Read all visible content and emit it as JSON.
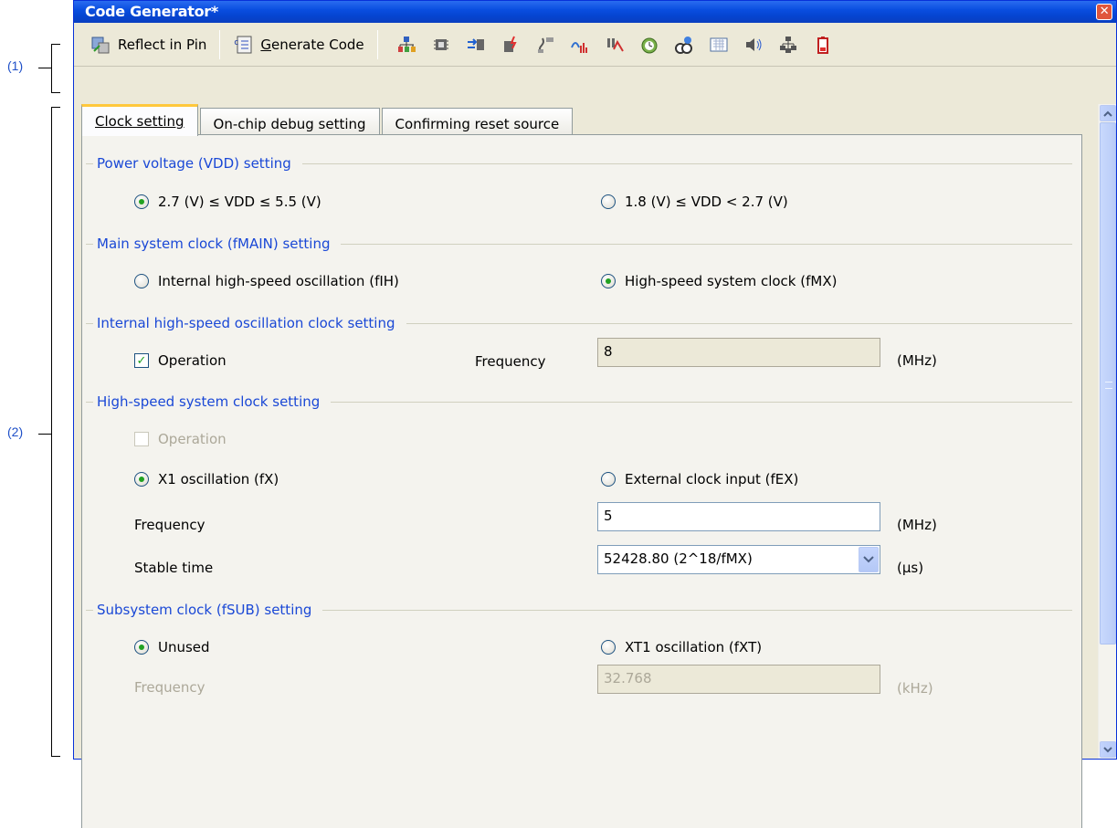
{
  "callouts": {
    "c1": "(1)",
    "c2": "(2)"
  },
  "window": {
    "title": "Code Generator*",
    "close_glyph": "✕"
  },
  "toolbar": {
    "reflect_label": "Reflect in Pin",
    "generate_label": "Generate Code",
    "icon_names": [
      "pin-config-icon",
      "chip-icon",
      "port-icon",
      "interrupt-icon",
      "serial-icon",
      "ad-converter-icon",
      "timer-icon",
      "watchdog-icon",
      "clock-output-icon",
      "display-icon",
      "buzzer-icon",
      "network-icon",
      "battery-icon"
    ]
  },
  "tabs": [
    "Clock setting",
    "On-chip debug setting",
    "Confirming reset source"
  ],
  "groups": {
    "power": "Power voltage (VDD) setting",
    "main_clock": "Main system clock (fMAIN) setting",
    "internal": "Internal high-speed oscillation clock setting",
    "highspeed": "High-speed system clock setting",
    "subsystem": "Subsystem clock (fSUB) setting"
  },
  "power": {
    "opt1": "2.7 (V) ≤ VDD ≤ 5.5 (V)",
    "opt2": "1.8 (V) ≤ VDD < 2.7 (V)"
  },
  "main_clock": {
    "opt1": "Internal high-speed oscillation (fIH)",
    "opt2": "High-speed system clock (fMX)"
  },
  "internal": {
    "operation_label": "Operation",
    "frequency_label": "Frequency",
    "frequency_value": "8",
    "unit": "(MHz)"
  },
  "highspeed": {
    "operation_label": "Operation",
    "opt1": "X1 oscillation (fX)",
    "opt2": "External clock input (fEX)",
    "frequency_label": "Frequency",
    "frequency_value": "5",
    "frequency_unit": "(MHz)",
    "stable_label": "Stable time",
    "stable_value": "52428.80 (2^18/fMX)",
    "stable_unit": "(µs)"
  },
  "subsystem": {
    "opt1": "Unused",
    "opt2": "XT1 oscillation (fXT)",
    "frequency_label": "Frequency",
    "frequency_value": "32.768",
    "unit": "(kHz)"
  }
}
